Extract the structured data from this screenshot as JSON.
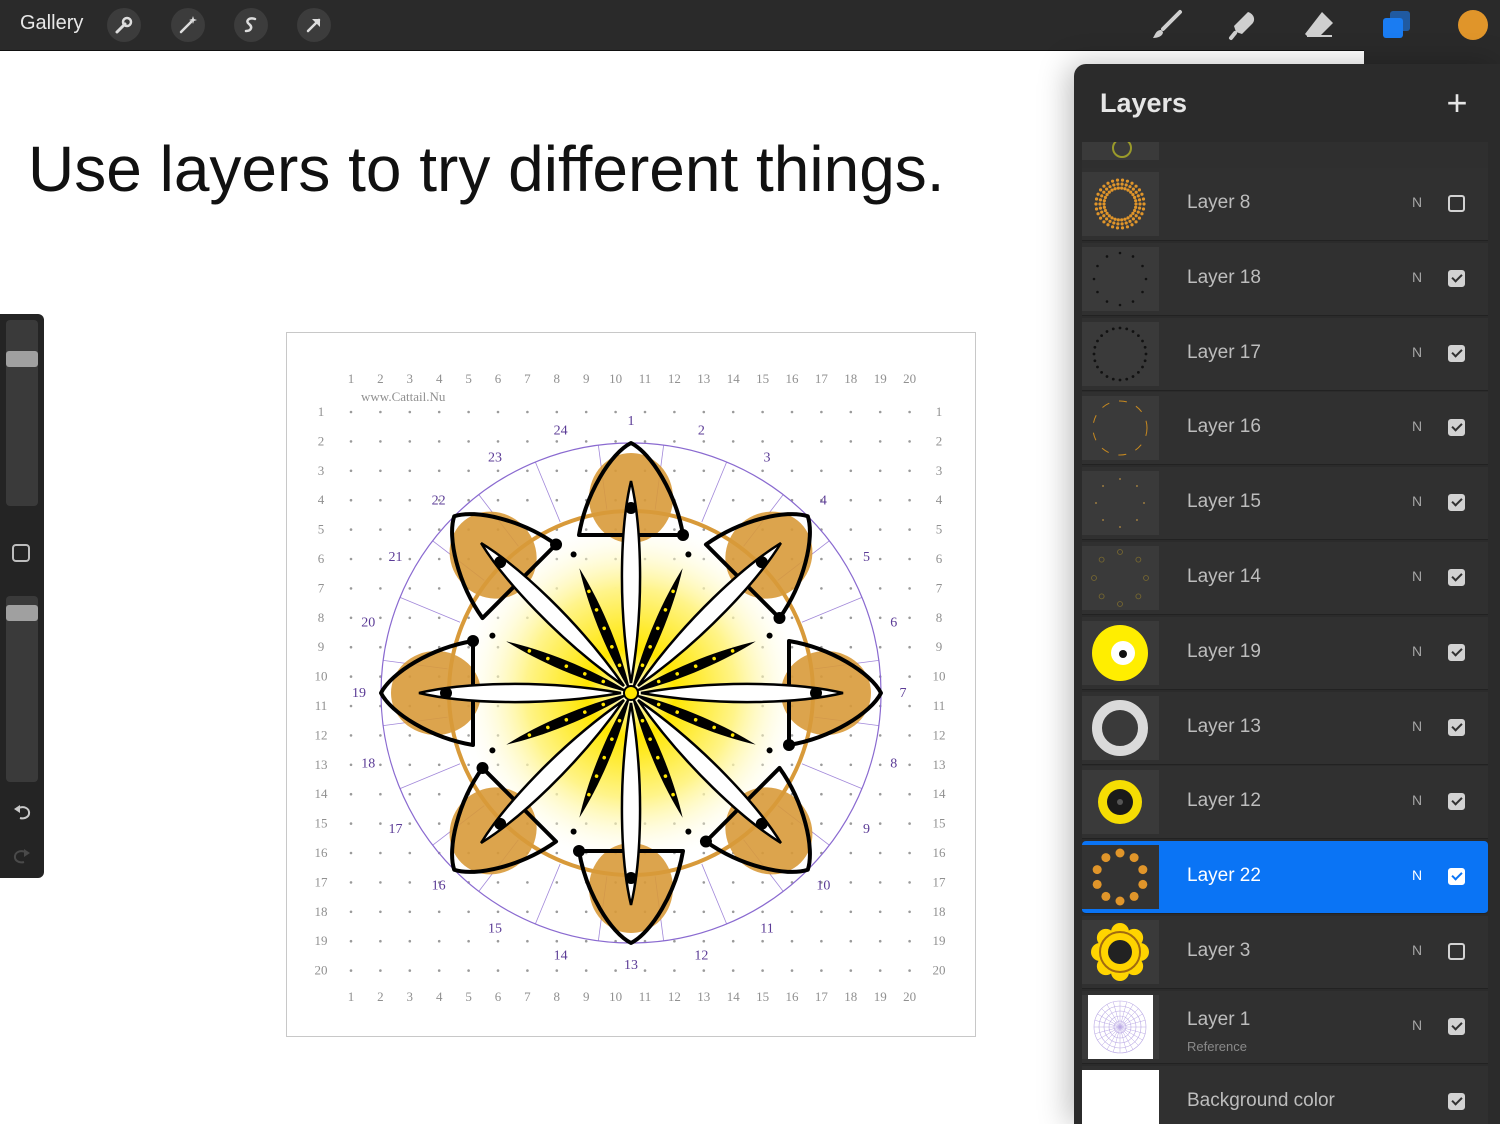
{
  "topbar": {
    "gallery_label": "Gallery",
    "left_tools": [
      "wrench-icon",
      "magic-wand-icon",
      "selection-icon",
      "transform-arrow-icon"
    ],
    "right_tools": [
      "brush-icon",
      "smudge-icon",
      "eraser-icon",
      "layers-icon",
      "color-swatch"
    ],
    "active_color": "#e0952a",
    "layers_icon_color": "#1a7cf2"
  },
  "caption": "Use layers to try different things.",
  "sidebar": {
    "brush_size_level": 0.82,
    "opacity_level": 0.95
  },
  "artwork": {
    "watermark": "www.Cattail.Nu",
    "grid_numbers": [
      "1",
      "2",
      "3",
      "4",
      "5",
      "6",
      "7",
      "8",
      "9",
      "10",
      "11",
      "12",
      "13",
      "14",
      "15",
      "16",
      "17",
      "18",
      "19",
      "20"
    ],
    "ring_numbers": [
      "1",
      "2",
      "3",
      "4",
      "5",
      "6",
      "7",
      "8",
      "9",
      "10",
      "11",
      "12",
      "13",
      "14",
      "15",
      "16",
      "17",
      "18",
      "19",
      "20",
      "21",
      "22",
      "23",
      "24"
    ],
    "colors": {
      "guide": "#8a6ad0",
      "petal": "#d89a3a",
      "yellow": "#ffe600",
      "ink": "#000000"
    }
  },
  "layers_panel": {
    "title": "Layers",
    "add_symbol": "+",
    "layers": [
      {
        "name": "Layer 8",
        "mode": "N",
        "visible": false,
        "thumb": "dotted-ring"
      },
      {
        "name": "Layer 18",
        "mode": "N",
        "visible": true,
        "thumb": "sparse-dots"
      },
      {
        "name": "Layer 17",
        "mode": "N",
        "visible": true,
        "thumb": "dot-ring"
      },
      {
        "name": "Layer 16",
        "mode": "N",
        "visible": true,
        "thumb": "dash-ring"
      },
      {
        "name": "Layer 15",
        "mode": "N",
        "visible": true,
        "thumb": "faint-dots"
      },
      {
        "name": "Layer 14",
        "mode": "N",
        "visible": true,
        "thumb": "chevrons"
      },
      {
        "name": "Layer 19",
        "mode": "N",
        "visible": true,
        "thumb": "yellow-circle"
      },
      {
        "name": "Layer 13",
        "mode": "N",
        "visible": true,
        "thumb": "white-ring"
      },
      {
        "name": "Layer 12",
        "mode": "N",
        "visible": true,
        "thumb": "yellow-ring"
      },
      {
        "name": "Layer 22",
        "mode": "N",
        "visible": true,
        "selected": true,
        "thumb": "orange-dots"
      },
      {
        "name": "Layer 3",
        "mode": "N",
        "visible": false,
        "thumb": "yellow-flower"
      },
      {
        "name": "Layer 1",
        "sub": "Reference",
        "mode": "N",
        "visible": true,
        "thumb": "guide-grid"
      },
      {
        "name": "Background color",
        "mode": "",
        "visible": true,
        "thumb": "white"
      }
    ]
  }
}
